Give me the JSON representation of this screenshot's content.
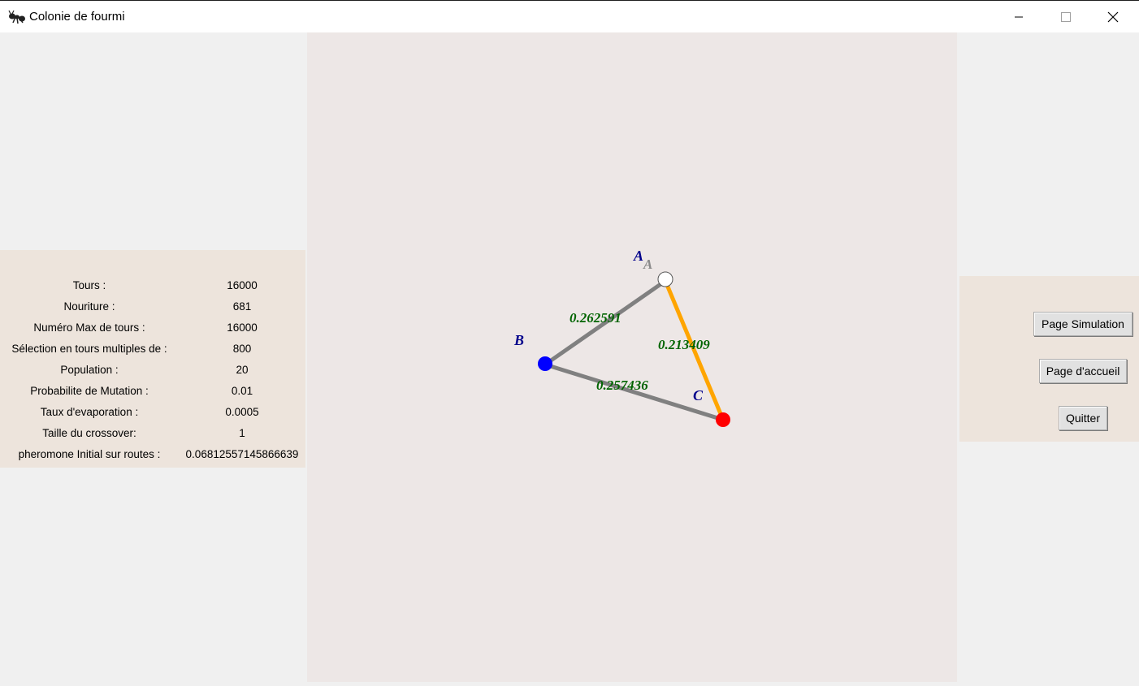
{
  "window": {
    "title": "Colonie de fourmi",
    "icon": "ant-icon"
  },
  "parameters": [
    {
      "label": "Tours :",
      "value": "16000"
    },
    {
      "label": "Nouriture :",
      "value": "681"
    },
    {
      "label": "Numéro Max de tours :",
      "value": "16000"
    },
    {
      "label": "Sélection en tours multiples de :",
      "value": "800"
    },
    {
      "label": "Population :",
      "value": "20"
    },
    {
      "label": "Probabilite de Mutation :",
      "value": "0.01"
    },
    {
      "label": "Taux d'evaporation :",
      "value": "0.0005"
    },
    {
      "label": "Taille du crossover:",
      "value": "1"
    },
    {
      "label": "pheromone Initial sur routes :",
      "value": "0.06812557145866639"
    }
  ],
  "graph": {
    "nodes": [
      {
        "name": "A",
        "marker_label": "A",
        "fill": "#ffffff",
        "label_color": "#00008b"
      },
      {
        "name": "B",
        "fill": "#0000ff",
        "label_color": "#00008b"
      },
      {
        "name": "C",
        "fill": "#ff0000",
        "label_color": "#00008b"
      }
    ],
    "edges": [
      {
        "from": "A",
        "to": "B",
        "weight": "0.262591",
        "color": "#808080"
      },
      {
        "from": "A",
        "to": "C",
        "weight": "0.213409",
        "color": "#ffa500"
      },
      {
        "from": "B",
        "to": "C",
        "weight": "0.257436",
        "color": "#808080"
      }
    ],
    "weight_color": "#006400"
  },
  "buttons": {
    "simulation": "Page Simulation",
    "accueil": "Page d'accueil",
    "quitter": "Quitter"
  }
}
